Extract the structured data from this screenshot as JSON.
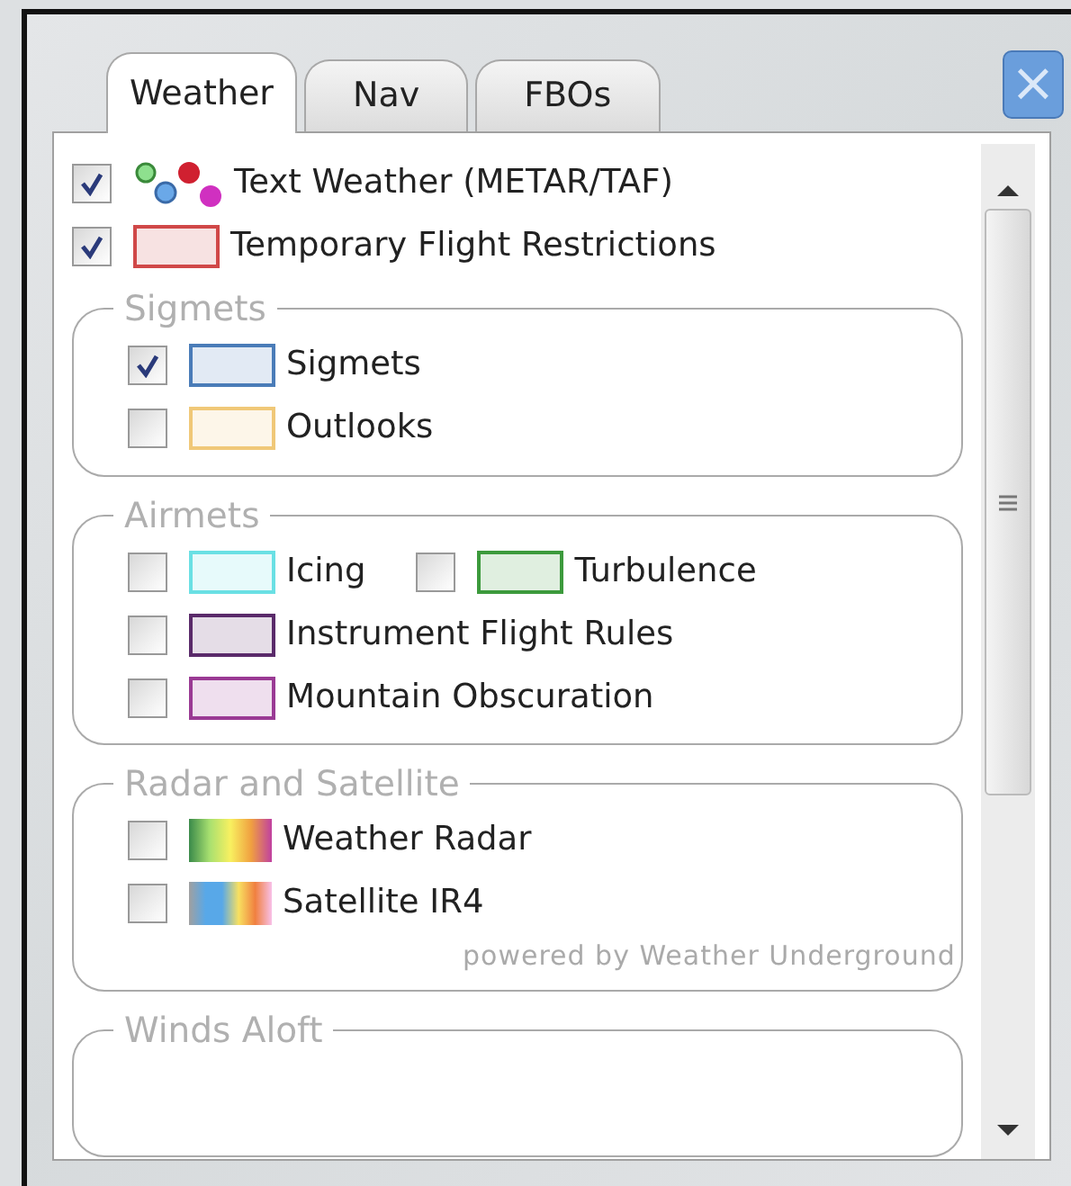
{
  "tabs": [
    {
      "label": "Weather",
      "selected": true
    },
    {
      "label": "Nav",
      "selected": false
    },
    {
      "label": "FBOs",
      "selected": false
    }
  ],
  "close_button": {
    "label": "×"
  },
  "top_items": [
    {
      "kind": "dots",
      "label": "Text Weather (METAR/TAF)",
      "checked": true
    },
    {
      "kind": "swatch",
      "label": "Temporary Flight Restrictions",
      "checked": true,
      "color": "#d04848"
    }
  ],
  "groups": [
    {
      "title": "Sigmets",
      "rows": [
        [
          {
            "kind": "swatch",
            "label": "Sigmets",
            "checked": true,
            "color": "#4a7cb8"
          }
        ],
        [
          {
            "kind": "swatch",
            "label": "Outlooks",
            "checked": false,
            "color": "#f0c878"
          }
        ]
      ]
    },
    {
      "title": "Airmets",
      "rows": [
        [
          {
            "kind": "swatch",
            "label": "Icing",
            "checked": false,
            "color": "#6ae0e4"
          },
          {
            "kind": "swatch",
            "label": "Turbulence",
            "checked": false,
            "color": "#3c9a3c"
          }
        ],
        [
          {
            "kind": "swatch",
            "label": "Instrument Flight Rules",
            "checked": false,
            "color": "#5a2a6a"
          }
        ],
        [
          {
            "kind": "swatch",
            "label": "Mountain Obscuration",
            "checked": false,
            "color": "#9a3a94"
          }
        ]
      ]
    },
    {
      "title": "Radar and Satellite",
      "rows": [
        [
          {
            "kind": "radar",
            "label": "Weather Radar",
            "checked": false
          }
        ],
        [
          {
            "kind": "satellite",
            "label": "Satellite IR4",
            "checked": false
          }
        ]
      ],
      "credit": "powered by Weather Underground"
    },
    {
      "title": "Winds Aloft"
    }
  ]
}
